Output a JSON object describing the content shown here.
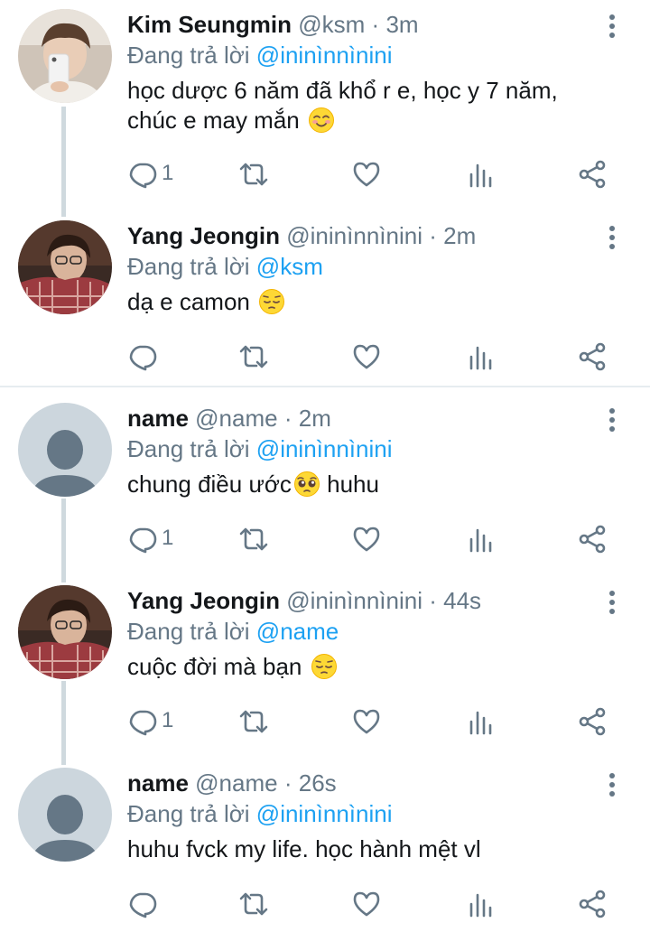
{
  "colors": {
    "text": "#14171a",
    "secondary": "#657786",
    "mention": "#1da1f2",
    "thread_line": "#cfd9de",
    "divider": "#e6ecf0"
  },
  "tweets": [
    {
      "display_name": "Kim Seungmin",
      "handle": "@ksm",
      "dot": "·",
      "time": "3m",
      "reply_prefix": "Đang trả lời",
      "reply_mention": "@ininìnnìnini",
      "text": "học dược 6 năm đã khổ r e, học y 7 năm,\nchúc e may mắn",
      "emoji": "smiling-blush",
      "reply_count": "1",
      "avatar": "photo-kim-seungmin"
    },
    {
      "display_name": "Yang Jeongin",
      "handle": "@ininìnnìnini",
      "dot": "·",
      "time": "2m",
      "reply_prefix": "Đang trả lời",
      "reply_mention": "@ksm",
      "text": "dạ e camon",
      "emoji": "pensive",
      "reply_count": "",
      "avatar": "photo-yang-jeongin"
    },
    {
      "display_name": "name",
      "handle": "@name",
      "dot": "·",
      "time": "2m",
      "reply_prefix": "Đang trả lời",
      "reply_mention": "@ininìnnìnini",
      "text": "chung điều ước",
      "emoji": "pleading",
      "text_after": " huhu",
      "reply_count": "1",
      "avatar": "default-avatar"
    },
    {
      "display_name": "Yang Jeongin",
      "handle": "@ininìnnìnini",
      "dot": "·",
      "time": "44s",
      "reply_prefix": "Đang trả lời",
      "reply_mention": "@name",
      "text": "cuộc đời mà bạn",
      "emoji": "pensive",
      "reply_count": "1",
      "avatar": "photo-yang-jeongin"
    },
    {
      "display_name": "name",
      "handle": "@name",
      "dot": "·",
      "time": "26s",
      "reply_prefix": "Đang trả lời",
      "reply_mention": "@ininìnnìnini",
      "text": "huhu fvck my life. học hành mệt vl",
      "emoji": "",
      "reply_count": "",
      "avatar": "default-avatar"
    }
  ]
}
